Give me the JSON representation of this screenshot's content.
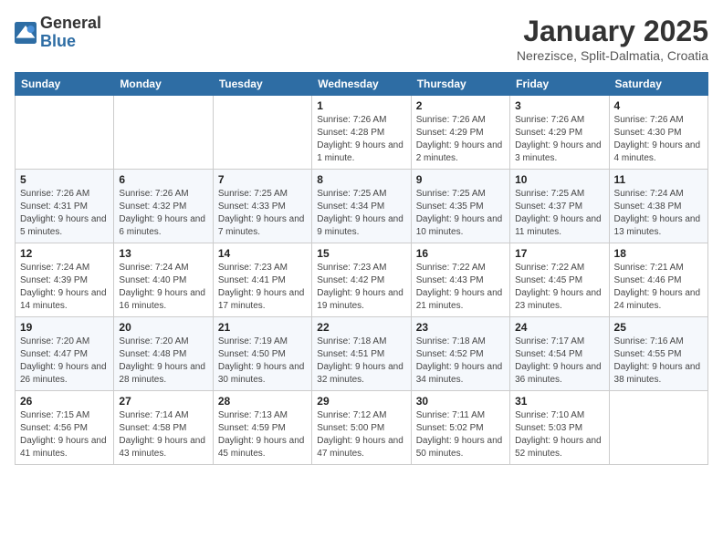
{
  "logo": {
    "general": "General",
    "blue": "Blue"
  },
  "title": "January 2025",
  "location": "Nerezisce, Split-Dalmatia, Croatia",
  "weekdays": [
    "Sunday",
    "Monday",
    "Tuesday",
    "Wednesday",
    "Thursday",
    "Friday",
    "Saturday"
  ],
  "weeks": [
    [
      {
        "day": "",
        "info": ""
      },
      {
        "day": "",
        "info": ""
      },
      {
        "day": "",
        "info": ""
      },
      {
        "day": "1",
        "info": "Sunrise: 7:26 AM\nSunset: 4:28 PM\nDaylight: 9 hours and 1 minute."
      },
      {
        "day": "2",
        "info": "Sunrise: 7:26 AM\nSunset: 4:29 PM\nDaylight: 9 hours and 2 minutes."
      },
      {
        "day": "3",
        "info": "Sunrise: 7:26 AM\nSunset: 4:29 PM\nDaylight: 9 hours and 3 minutes."
      },
      {
        "day": "4",
        "info": "Sunrise: 7:26 AM\nSunset: 4:30 PM\nDaylight: 9 hours and 4 minutes."
      }
    ],
    [
      {
        "day": "5",
        "info": "Sunrise: 7:26 AM\nSunset: 4:31 PM\nDaylight: 9 hours and 5 minutes."
      },
      {
        "day": "6",
        "info": "Sunrise: 7:26 AM\nSunset: 4:32 PM\nDaylight: 9 hours and 6 minutes."
      },
      {
        "day": "7",
        "info": "Sunrise: 7:25 AM\nSunset: 4:33 PM\nDaylight: 9 hours and 7 minutes."
      },
      {
        "day": "8",
        "info": "Sunrise: 7:25 AM\nSunset: 4:34 PM\nDaylight: 9 hours and 9 minutes."
      },
      {
        "day": "9",
        "info": "Sunrise: 7:25 AM\nSunset: 4:35 PM\nDaylight: 9 hours and 10 minutes."
      },
      {
        "day": "10",
        "info": "Sunrise: 7:25 AM\nSunset: 4:37 PM\nDaylight: 9 hours and 11 minutes."
      },
      {
        "day": "11",
        "info": "Sunrise: 7:24 AM\nSunset: 4:38 PM\nDaylight: 9 hours and 13 minutes."
      }
    ],
    [
      {
        "day": "12",
        "info": "Sunrise: 7:24 AM\nSunset: 4:39 PM\nDaylight: 9 hours and 14 minutes."
      },
      {
        "day": "13",
        "info": "Sunrise: 7:24 AM\nSunset: 4:40 PM\nDaylight: 9 hours and 16 minutes."
      },
      {
        "day": "14",
        "info": "Sunrise: 7:23 AM\nSunset: 4:41 PM\nDaylight: 9 hours and 17 minutes."
      },
      {
        "day": "15",
        "info": "Sunrise: 7:23 AM\nSunset: 4:42 PM\nDaylight: 9 hours and 19 minutes."
      },
      {
        "day": "16",
        "info": "Sunrise: 7:22 AM\nSunset: 4:43 PM\nDaylight: 9 hours and 21 minutes."
      },
      {
        "day": "17",
        "info": "Sunrise: 7:22 AM\nSunset: 4:45 PM\nDaylight: 9 hours and 23 minutes."
      },
      {
        "day": "18",
        "info": "Sunrise: 7:21 AM\nSunset: 4:46 PM\nDaylight: 9 hours and 24 minutes."
      }
    ],
    [
      {
        "day": "19",
        "info": "Sunrise: 7:20 AM\nSunset: 4:47 PM\nDaylight: 9 hours and 26 minutes."
      },
      {
        "day": "20",
        "info": "Sunrise: 7:20 AM\nSunset: 4:48 PM\nDaylight: 9 hours and 28 minutes."
      },
      {
        "day": "21",
        "info": "Sunrise: 7:19 AM\nSunset: 4:50 PM\nDaylight: 9 hours and 30 minutes."
      },
      {
        "day": "22",
        "info": "Sunrise: 7:18 AM\nSunset: 4:51 PM\nDaylight: 9 hours and 32 minutes."
      },
      {
        "day": "23",
        "info": "Sunrise: 7:18 AM\nSunset: 4:52 PM\nDaylight: 9 hours and 34 minutes."
      },
      {
        "day": "24",
        "info": "Sunrise: 7:17 AM\nSunset: 4:54 PM\nDaylight: 9 hours and 36 minutes."
      },
      {
        "day": "25",
        "info": "Sunrise: 7:16 AM\nSunset: 4:55 PM\nDaylight: 9 hours and 38 minutes."
      }
    ],
    [
      {
        "day": "26",
        "info": "Sunrise: 7:15 AM\nSunset: 4:56 PM\nDaylight: 9 hours and 41 minutes."
      },
      {
        "day": "27",
        "info": "Sunrise: 7:14 AM\nSunset: 4:58 PM\nDaylight: 9 hours and 43 minutes."
      },
      {
        "day": "28",
        "info": "Sunrise: 7:13 AM\nSunset: 4:59 PM\nDaylight: 9 hours and 45 minutes."
      },
      {
        "day": "29",
        "info": "Sunrise: 7:12 AM\nSunset: 5:00 PM\nDaylight: 9 hours and 47 minutes."
      },
      {
        "day": "30",
        "info": "Sunrise: 7:11 AM\nSunset: 5:02 PM\nDaylight: 9 hours and 50 minutes."
      },
      {
        "day": "31",
        "info": "Sunrise: 7:10 AM\nSunset: 5:03 PM\nDaylight: 9 hours and 52 minutes."
      },
      {
        "day": "",
        "info": ""
      }
    ]
  ]
}
